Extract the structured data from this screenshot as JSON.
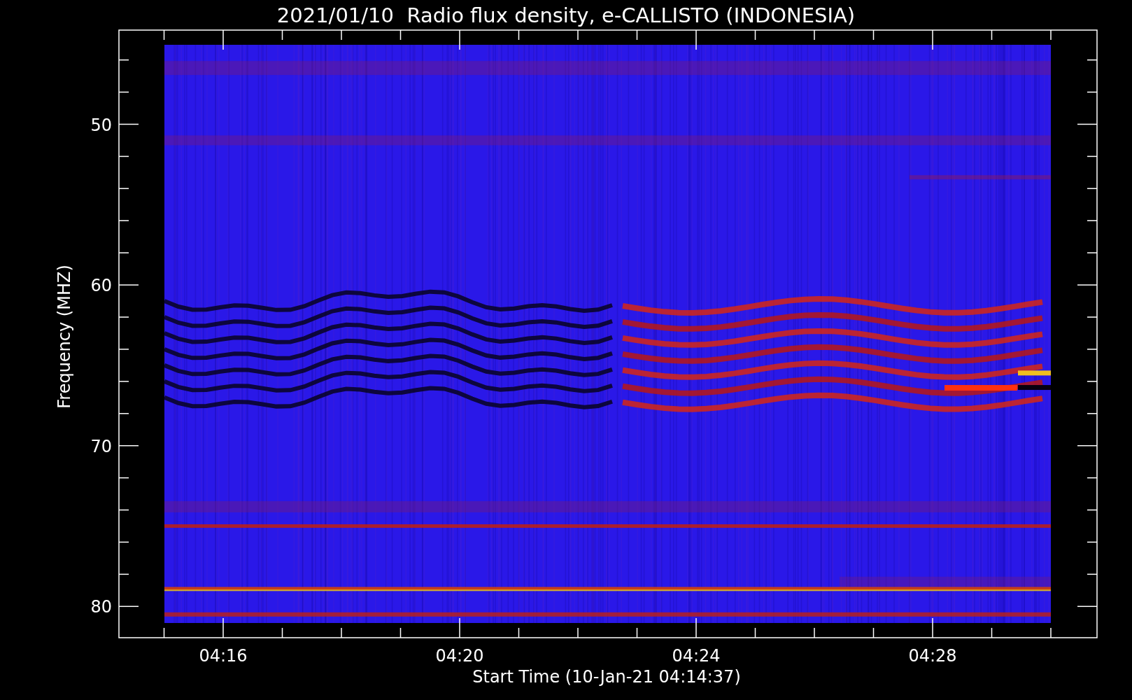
{
  "title": "2021/01/10  Radio flux density, e-CALLISTO (INDONESIA)",
  "plot": {
    "ylabel": "Frequency (MHZ)",
    "xlabel": "Start Time (10-Jan-21 04:14:37)",
    "yticks": [
      "50",
      "60",
      "70",
      "80"
    ],
    "xticks": [
      "04:16",
      "04:20",
      "04:24",
      "04:28"
    ]
  }
}
